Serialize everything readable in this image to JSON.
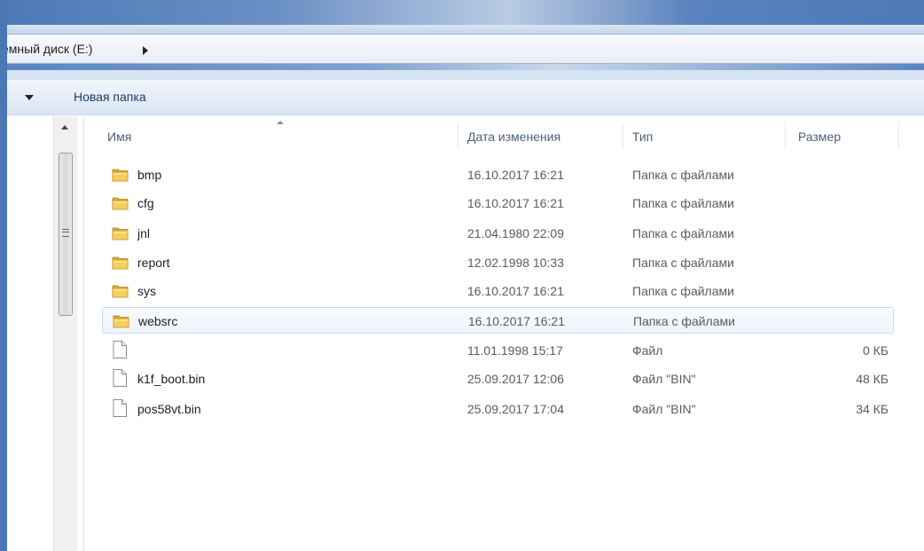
{
  "address_bar": {
    "path_label": "емный диск (E:)"
  },
  "toolbar": {
    "new_folder_label": "Новая папка"
  },
  "columns": {
    "name": "Имя",
    "date": "Дата изменения",
    "type": "Тип",
    "size": "Размер"
  },
  "files": [
    {
      "name": "bmp",
      "date": "16.10.2017 16:21",
      "type": "Папка с файлами",
      "size": "",
      "icon": "folder-icon"
    },
    {
      "name": "cfg",
      "date": "16.10.2017 16:21",
      "type": "Папка с файлами",
      "size": "",
      "icon": "folder-icon"
    },
    {
      "name": "jnl",
      "date": "21.04.1980 22:09",
      "type": "Папка с файлами",
      "size": "",
      "icon": "folder-icon"
    },
    {
      "name": "report",
      "date": "12.02.1998 10:33",
      "type": "Папка с файлами",
      "size": "",
      "icon": "folder-icon"
    },
    {
      "name": "sys",
      "date": "16.10.2017 16:21",
      "type": "Папка с файлами",
      "size": "",
      "icon": "folder-icon"
    },
    {
      "name": "websrc",
      "date": "16.10.2017 16:21",
      "type": "Папка с файлами",
      "size": "",
      "icon": "folder-icon",
      "selected": true
    },
    {
      "name": "",
      "date": "11.01.1998 15:17",
      "type": "Файл",
      "size": "0 КБ",
      "icon": "file-icon"
    },
    {
      "name": "k1f_boot.bin",
      "date": "25.09.2017 12:06",
      "type": "Файл \"BIN\"",
      "size": "48 КБ",
      "icon": "file-icon"
    },
    {
      "name": "pos58vt.bin",
      "date": "25.09.2017 17:04",
      "type": "Файл \"BIN\"",
      "size": "34 КБ",
      "icon": "file-icon"
    }
  ],
  "colors": {
    "window_frame": "#4b78b4",
    "toolbar_top": "#f3f7fc",
    "selection_border": "#c8daf0"
  }
}
